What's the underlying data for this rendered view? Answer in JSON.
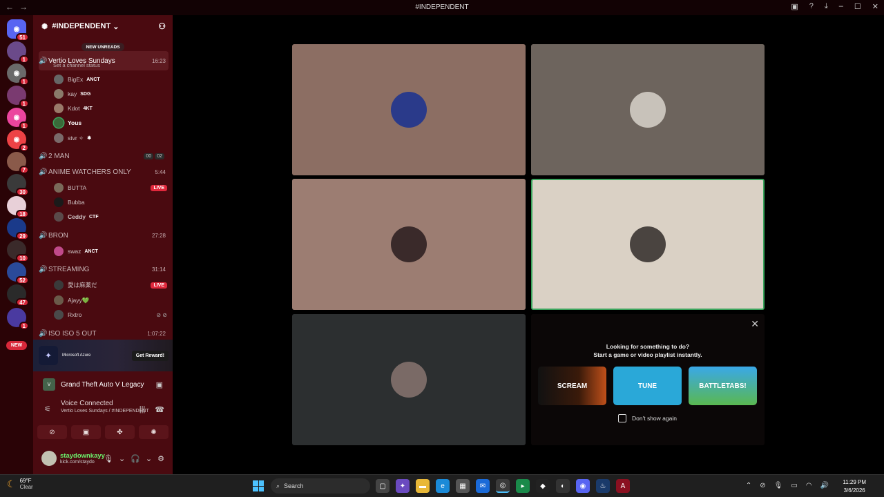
{
  "window": {
    "title": "#INDEPENDENT",
    "back": "←",
    "forward": "→"
  },
  "servers": [
    {
      "badge": "51",
      "color": "#5865f2"
    },
    {
      "badge": "1",
      "color": "#6b4a8a"
    },
    {
      "badge": "1",
      "color": "#6a6a6a"
    },
    {
      "badge": "1",
      "color": "#7a3a70"
    },
    {
      "badge": "1",
      "color": "#eb459e"
    },
    {
      "badge": "2",
      "color": "#ed4245"
    },
    {
      "badge": "7",
      "color": "#8a5a4a"
    },
    {
      "badge": "30",
      "color": "#3a3a3a"
    },
    {
      "badge": "18",
      "color": "#e8d0d8"
    },
    {
      "badge": "29",
      "color": "#1a3a8a"
    },
    {
      "badge": "10",
      "color": "#3a2a2a"
    },
    {
      "badge": "52",
      "color": "#2a4a9a"
    },
    {
      "badge": "47",
      "color": "#2a2a2a"
    },
    {
      "badge": "1",
      "color": "#4a3aa0"
    }
  ],
  "server_new": "NEW",
  "guild": {
    "name": "#INDEPENDENT",
    "new_unreads": "NEW UNREADS",
    "channel_status": "Set a channel status"
  },
  "channels": [
    {
      "name": "Vertio Loves Sundays",
      "time": "16:23"
    },
    {
      "name": "2 MAN",
      "time1": "00",
      "time2": "02"
    },
    {
      "name": "ANIME WATCHERS ONLY",
      "time": "5:44"
    },
    {
      "name": "BRON",
      "time": "27:28"
    },
    {
      "name": "STREAMING",
      "time": "31:14"
    },
    {
      "name": "ISO ISO 5 OUT",
      "time": "1:07:22"
    }
  ],
  "users": [
    {
      "name": "BigEx",
      "tag": "ANCT"
    },
    {
      "name": "kay",
      "tag": "SDG"
    },
    {
      "name": "Kdot",
      "tag": "4KT"
    },
    {
      "name": "Yous",
      "tag": ""
    },
    {
      "name": "stvr ✧",
      "tag": ""
    },
    {
      "name": "BUTTA",
      "tag": "",
      "live": "LIVE"
    },
    {
      "name": "Bubba",
      "tag": ""
    },
    {
      "name": "Ceddy",
      "tag": "CTF"
    },
    {
      "name": "swaz",
      "tag": "ANCT"
    },
    {
      "name": "愛は麻薬だ",
      "tag": "",
      "live": "LIVE"
    },
    {
      "name": "Ajayy💚",
      "tag": ""
    },
    {
      "name": "Rxtro",
      "tag": ""
    }
  ],
  "ad": {
    "brand": "Microsoft Azure",
    "cta": "Get Reward!"
  },
  "activity": {
    "game": "Grand Theft Auto V Legacy"
  },
  "voice": {
    "status": "Voice Connected",
    "channel": "Vertio Loves Sundays / #INDEPENDENT"
  },
  "user_panel": {
    "name": "staydownkayy",
    "sub": "kick.com/staydo"
  },
  "tiles": [
    {
      "bg": "#8c6e63",
      "avatar": "#2a3a8a"
    },
    {
      "bg": "#6d645d",
      "avatar": "#c8c2ba"
    },
    {
      "bg": "#9c7d72",
      "avatar": "#3a2a2a"
    },
    {
      "bg": "#dad1c5",
      "avatar": "#4a4440",
      "speaking": true
    },
    {
      "bg": "#2c2f30",
      "avatar": "#7a6a66"
    }
  ],
  "activity_card": {
    "line1": "Looking for something to do?",
    "line2": "Start a game or video playlist instantly.",
    "thumbs": [
      "SCREAM",
      "TUNE",
      "BATTLETABS!"
    ],
    "dont_show": "Don't show again"
  },
  "taskbar": {
    "temp": "69°F",
    "condition": "Clear",
    "search": "Search",
    "time": "11:29 PM",
    "date": "3/6/2026"
  }
}
